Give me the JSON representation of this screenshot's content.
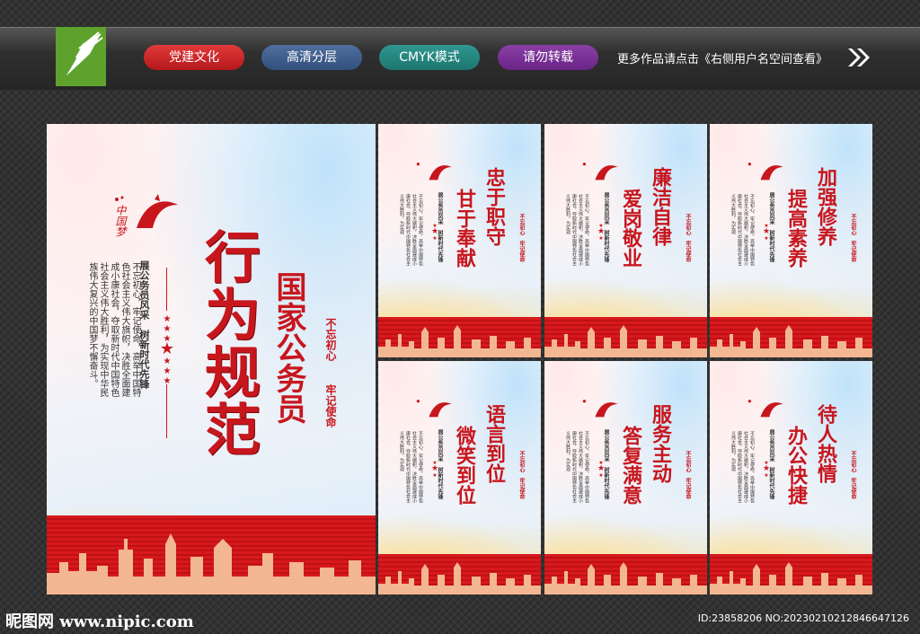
{
  "header": {
    "tags": [
      "党建文化",
      "高清分层",
      "CMYK模式",
      "请勿转载"
    ],
    "more_text": "更多作品请点击《右侧用户名空间查看》",
    "tag_colors": [
      "#c8161d",
      "#3f5f8e",
      "#2a8a84",
      "#7a2f98"
    ]
  },
  "main_poster": {
    "title": "行为规范",
    "subtitle": "国家公务员",
    "seal_1": "不忘初心",
    "seal_2": "牢记使命",
    "slogan": "展公务员风采　树新时代先锋",
    "body": "不忘初心，牢记使命，高举中国特色社会主义伟大旗帜，决胜全面建成小康社会，夺取新时代中国特色社会主义伟大胜利，为实现中华民族伟大复兴的中国梦不懈奋斗。",
    "emblem_text": "中国梦"
  },
  "small_posters": [
    {
      "title_col1": "忠于职守",
      "title_col2": "甘于奉献"
    },
    {
      "title_col1": "廉洁自律",
      "title_col2": "爱岗敬业"
    },
    {
      "title_col1": "加强修养",
      "title_col2": "提高素养"
    },
    {
      "title_col1": "语言到位",
      "title_col2": "微笑到位"
    },
    {
      "title_col1": "服务主动",
      "title_col2": "答复满意"
    },
    {
      "title_col1": "待人热情",
      "title_col2": "办公快捷"
    }
  ],
  "small_common": {
    "slogan": "展公务员风采　树新时代先锋",
    "body": "不忘初心，牢记使命，高举中国特色社会主义伟大旗帜，决胜全面建成小康社会，夺取新时代中国特色社会主义伟大胜利，为实现",
    "seal": "不忘初心　牢记使命"
  },
  "footer": {
    "site": "昵图网 www.nipic.com",
    "id": "ID:23858206 NO:20230210212846647126"
  }
}
